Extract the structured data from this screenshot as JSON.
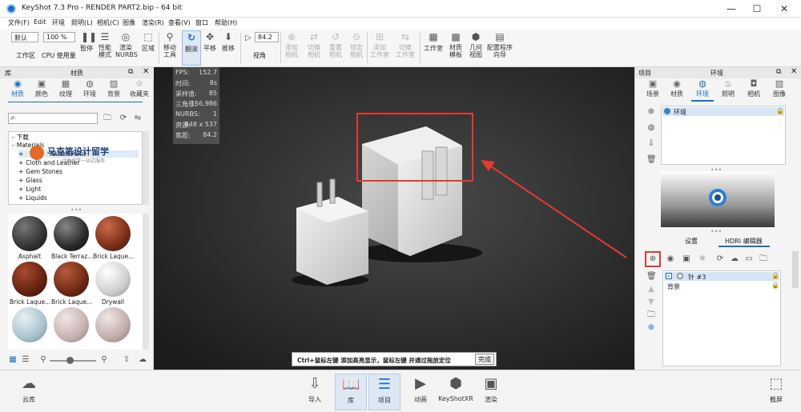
{
  "window": {
    "title": "KeyShot 7.3 Pro  -  RENDER PART2.bip  -  64 bit",
    "min": "—",
    "max": "☐",
    "close": "✕"
  },
  "menu": [
    "文件(F)",
    "Edit",
    "环境",
    "照明(L)",
    "相机(C)",
    "图像",
    "渲染(R)",
    "查看(V)",
    "窗口",
    "帮助(H)"
  ],
  "toolbar": {
    "workspace_select": "默认",
    "workspace_label": "工作区",
    "cpu_select": "100 %",
    "cpu_label": "CPU 使用量",
    "pause": "暂停",
    "perf": "性能\n模式",
    "nurbs": "渲染\nNURBS",
    "region": "区域",
    "move_tool": "移动\n工具",
    "tumble": "翻滚",
    "pan": "平移",
    "dolly": "推移",
    "fov_value": "84.2",
    "fov_label": "视角",
    "add_cam": "添加\n相机",
    "switch_cam": "切换\n相机",
    "reset_cam": "重置\n相机",
    "lock_cam": "锁定\n相机",
    "add_studio": "添加\n工作室",
    "switch_studio": "切换\n工作室",
    "studio": "工作室",
    "mat_tpl": "材质\n模板",
    "geo_view": "几何\n视图",
    "config": "配置程序\n向导"
  },
  "left": {
    "header": "库",
    "subheader": "材质",
    "tabs": [
      "材质",
      "颜色",
      "纹理",
      "环境",
      "背景",
      "收藏夹"
    ],
    "tree": [
      "下载",
      "Materials",
      "Axalta Paint",
      "Cloth and Leather",
      "Gem Stones",
      "Glass",
      "Light",
      "Liquids"
    ],
    "watermark": "马克笔设计留学",
    "watermark_sub": "计类留学一站式服务",
    "swatches": [
      "Asphalt",
      "Black Terraz...",
      "Brick Laque...",
      "Brick Laque...",
      "Brick Laque...",
      "Drywall",
      "",
      "",
      ""
    ]
  },
  "stats": [
    [
      "FPS:",
      "152.7"
    ],
    [
      "时间:",
      "8s"
    ],
    [
      "采样值:",
      "85"
    ],
    [
      "三角形:",
      "156,986"
    ],
    [
      "NURBS:",
      "1"
    ],
    [
      "资源:",
      "848 x 537"
    ],
    [
      "焦距:",
      "84.2"
    ]
  ],
  "hint": {
    "text": "Ctrl+鼠标左键 添加高亮显示，鼠标左键 并通过拖放定位",
    "done": "完成"
  },
  "right": {
    "header_left": "项目",
    "header_center": "环境",
    "tabs": [
      "场景",
      "材质",
      "环境",
      "照明",
      "相机",
      "图像"
    ],
    "env_item": "环境",
    "subtabs": [
      "设置",
      "HDRI 编辑器"
    ],
    "pins": [
      "针 #3",
      "背景"
    ]
  },
  "bottom": {
    "cloud": "云库",
    "import": "导入",
    "library": "库",
    "project": "项目",
    "animation": "动画",
    "keyshotxr": "KeyShotXR",
    "render": "渲染",
    "screenshot": "截屏"
  },
  "colors": {
    "accent": "#1d6ec8",
    "viewport": "#2b2b2b",
    "annotation": "#e53935"
  }
}
